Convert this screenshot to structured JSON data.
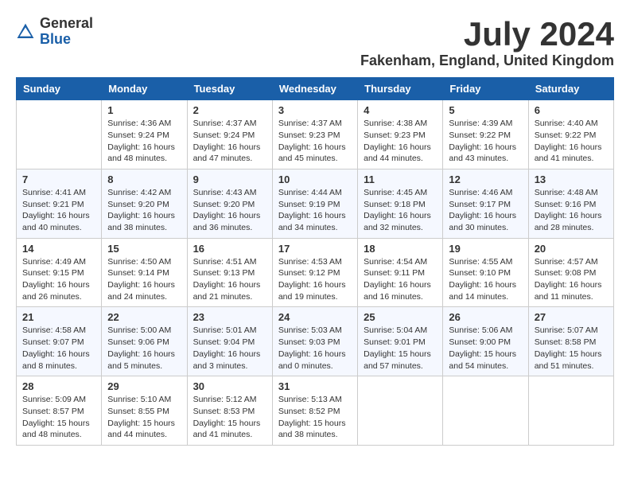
{
  "header": {
    "logo_general": "General",
    "logo_blue": "Blue",
    "month_year": "July 2024",
    "location": "Fakenham, England, United Kingdom"
  },
  "weekdays": [
    "Sunday",
    "Monday",
    "Tuesday",
    "Wednesday",
    "Thursday",
    "Friday",
    "Saturday"
  ],
  "weeks": [
    [
      {
        "day": "",
        "sunrise": "",
        "sunset": "",
        "daylight": ""
      },
      {
        "day": "1",
        "sunrise": "Sunrise: 4:36 AM",
        "sunset": "Sunset: 9:24 PM",
        "daylight": "Daylight: 16 hours and 48 minutes."
      },
      {
        "day": "2",
        "sunrise": "Sunrise: 4:37 AM",
        "sunset": "Sunset: 9:24 PM",
        "daylight": "Daylight: 16 hours and 47 minutes."
      },
      {
        "day": "3",
        "sunrise": "Sunrise: 4:37 AM",
        "sunset": "Sunset: 9:23 PM",
        "daylight": "Daylight: 16 hours and 45 minutes."
      },
      {
        "day": "4",
        "sunrise": "Sunrise: 4:38 AM",
        "sunset": "Sunset: 9:23 PM",
        "daylight": "Daylight: 16 hours and 44 minutes."
      },
      {
        "day": "5",
        "sunrise": "Sunrise: 4:39 AM",
        "sunset": "Sunset: 9:22 PM",
        "daylight": "Daylight: 16 hours and 43 minutes."
      },
      {
        "day": "6",
        "sunrise": "Sunrise: 4:40 AM",
        "sunset": "Sunset: 9:22 PM",
        "daylight": "Daylight: 16 hours and 41 minutes."
      }
    ],
    [
      {
        "day": "7",
        "sunrise": "Sunrise: 4:41 AM",
        "sunset": "Sunset: 9:21 PM",
        "daylight": "Daylight: 16 hours and 40 minutes."
      },
      {
        "day": "8",
        "sunrise": "Sunrise: 4:42 AM",
        "sunset": "Sunset: 9:20 PM",
        "daylight": "Daylight: 16 hours and 38 minutes."
      },
      {
        "day": "9",
        "sunrise": "Sunrise: 4:43 AM",
        "sunset": "Sunset: 9:20 PM",
        "daylight": "Daylight: 16 hours and 36 minutes."
      },
      {
        "day": "10",
        "sunrise": "Sunrise: 4:44 AM",
        "sunset": "Sunset: 9:19 PM",
        "daylight": "Daylight: 16 hours and 34 minutes."
      },
      {
        "day": "11",
        "sunrise": "Sunrise: 4:45 AM",
        "sunset": "Sunset: 9:18 PM",
        "daylight": "Daylight: 16 hours and 32 minutes."
      },
      {
        "day": "12",
        "sunrise": "Sunrise: 4:46 AM",
        "sunset": "Sunset: 9:17 PM",
        "daylight": "Daylight: 16 hours and 30 minutes."
      },
      {
        "day": "13",
        "sunrise": "Sunrise: 4:48 AM",
        "sunset": "Sunset: 9:16 PM",
        "daylight": "Daylight: 16 hours and 28 minutes."
      }
    ],
    [
      {
        "day": "14",
        "sunrise": "Sunrise: 4:49 AM",
        "sunset": "Sunset: 9:15 PM",
        "daylight": "Daylight: 16 hours and 26 minutes."
      },
      {
        "day": "15",
        "sunrise": "Sunrise: 4:50 AM",
        "sunset": "Sunset: 9:14 PM",
        "daylight": "Daylight: 16 hours and 24 minutes."
      },
      {
        "day": "16",
        "sunrise": "Sunrise: 4:51 AM",
        "sunset": "Sunset: 9:13 PM",
        "daylight": "Daylight: 16 hours and 21 minutes."
      },
      {
        "day": "17",
        "sunrise": "Sunrise: 4:53 AM",
        "sunset": "Sunset: 9:12 PM",
        "daylight": "Daylight: 16 hours and 19 minutes."
      },
      {
        "day": "18",
        "sunrise": "Sunrise: 4:54 AM",
        "sunset": "Sunset: 9:11 PM",
        "daylight": "Daylight: 16 hours and 16 minutes."
      },
      {
        "day": "19",
        "sunrise": "Sunrise: 4:55 AM",
        "sunset": "Sunset: 9:10 PM",
        "daylight": "Daylight: 16 hours and 14 minutes."
      },
      {
        "day": "20",
        "sunrise": "Sunrise: 4:57 AM",
        "sunset": "Sunset: 9:08 PM",
        "daylight": "Daylight: 16 hours and 11 minutes."
      }
    ],
    [
      {
        "day": "21",
        "sunrise": "Sunrise: 4:58 AM",
        "sunset": "Sunset: 9:07 PM",
        "daylight": "Daylight: 16 hours and 8 minutes."
      },
      {
        "day": "22",
        "sunrise": "Sunrise: 5:00 AM",
        "sunset": "Sunset: 9:06 PM",
        "daylight": "Daylight: 16 hours and 5 minutes."
      },
      {
        "day": "23",
        "sunrise": "Sunrise: 5:01 AM",
        "sunset": "Sunset: 9:04 PM",
        "daylight": "Daylight: 16 hours and 3 minutes."
      },
      {
        "day": "24",
        "sunrise": "Sunrise: 5:03 AM",
        "sunset": "Sunset: 9:03 PM",
        "daylight": "Daylight: 16 hours and 0 minutes."
      },
      {
        "day": "25",
        "sunrise": "Sunrise: 5:04 AM",
        "sunset": "Sunset: 9:01 PM",
        "daylight": "Daylight: 15 hours and 57 minutes."
      },
      {
        "day": "26",
        "sunrise": "Sunrise: 5:06 AM",
        "sunset": "Sunset: 9:00 PM",
        "daylight": "Daylight: 15 hours and 54 minutes."
      },
      {
        "day": "27",
        "sunrise": "Sunrise: 5:07 AM",
        "sunset": "Sunset: 8:58 PM",
        "daylight": "Daylight: 15 hours and 51 minutes."
      }
    ],
    [
      {
        "day": "28",
        "sunrise": "Sunrise: 5:09 AM",
        "sunset": "Sunset: 8:57 PM",
        "daylight": "Daylight: 15 hours and 48 minutes."
      },
      {
        "day": "29",
        "sunrise": "Sunrise: 5:10 AM",
        "sunset": "Sunset: 8:55 PM",
        "daylight": "Daylight: 15 hours and 44 minutes."
      },
      {
        "day": "30",
        "sunrise": "Sunrise: 5:12 AM",
        "sunset": "Sunset: 8:53 PM",
        "daylight": "Daylight: 15 hours and 41 minutes."
      },
      {
        "day": "31",
        "sunrise": "Sunrise: 5:13 AM",
        "sunset": "Sunset: 8:52 PM",
        "daylight": "Daylight: 15 hours and 38 minutes."
      },
      {
        "day": "",
        "sunrise": "",
        "sunset": "",
        "daylight": ""
      },
      {
        "day": "",
        "sunrise": "",
        "sunset": "",
        "daylight": ""
      },
      {
        "day": "",
        "sunrise": "",
        "sunset": "",
        "daylight": ""
      }
    ]
  ]
}
